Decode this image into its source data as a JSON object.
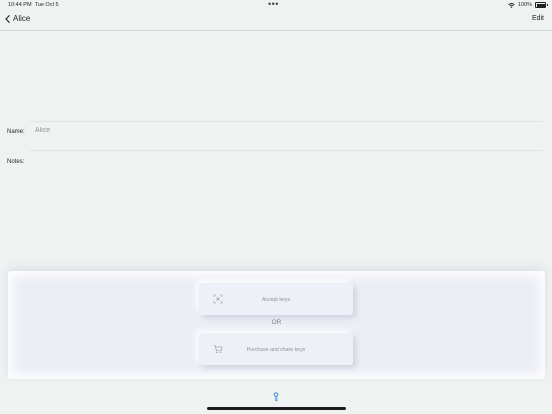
{
  "status_bar": {
    "time": "10:44 PM",
    "date": "Tue Oct 5",
    "battery": "100%"
  },
  "nav": {
    "title": "Alice",
    "edit_label": "Edit"
  },
  "form": {
    "name_label": "Name:",
    "name_value": "Alice",
    "notes_label": "Notes:",
    "notes_value": ""
  },
  "actions": {
    "accept_label": "Accept keys",
    "or_label": "OR",
    "purchase_label": "Purchase and share keys"
  },
  "colors": {
    "background": "#eef2f1",
    "panel": "#eceef6",
    "accent": "#2f7fd8"
  },
  "icons": [
    "chevron-left-icon",
    "wifi-icon",
    "battery-icon",
    "scan-icon",
    "cart-icon",
    "key-icon"
  ]
}
